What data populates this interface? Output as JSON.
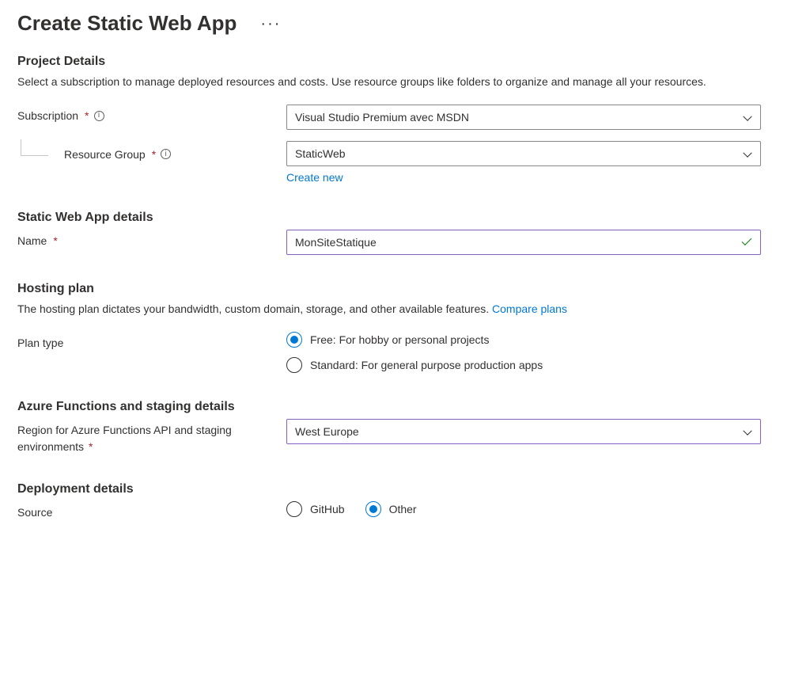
{
  "page": {
    "title": "Create Static Web App"
  },
  "project_details": {
    "heading": "Project Details",
    "description": "Select a subscription to manage deployed resources and costs. Use resource groups like folders to organize and manage all your resources.",
    "subscription_label": "Subscription",
    "subscription_value": "Visual Studio Premium avec MSDN",
    "resource_group_label": "Resource Group",
    "resource_group_value": "StaticWeb",
    "create_new": "Create new"
  },
  "swa_details": {
    "heading": "Static Web App details",
    "name_label": "Name",
    "name_value": "MonSiteStatique"
  },
  "hosting": {
    "heading": "Hosting plan",
    "description": "The hosting plan dictates your bandwidth, custom domain, storage, and other available features. ",
    "compare_link": "Compare plans",
    "plan_type_label": "Plan type",
    "options": {
      "free": "Free: For hobby or personal projects",
      "standard": "Standard: For general purpose production apps"
    },
    "selected": "free"
  },
  "functions": {
    "heading": "Azure Functions and staging details",
    "region_label": "Region for Azure Functions API and staging environments",
    "region_value": "West Europe"
  },
  "deployment": {
    "heading": "Deployment details",
    "source_label": "Source",
    "options": {
      "github": "GitHub",
      "other": "Other"
    },
    "selected": "other"
  }
}
